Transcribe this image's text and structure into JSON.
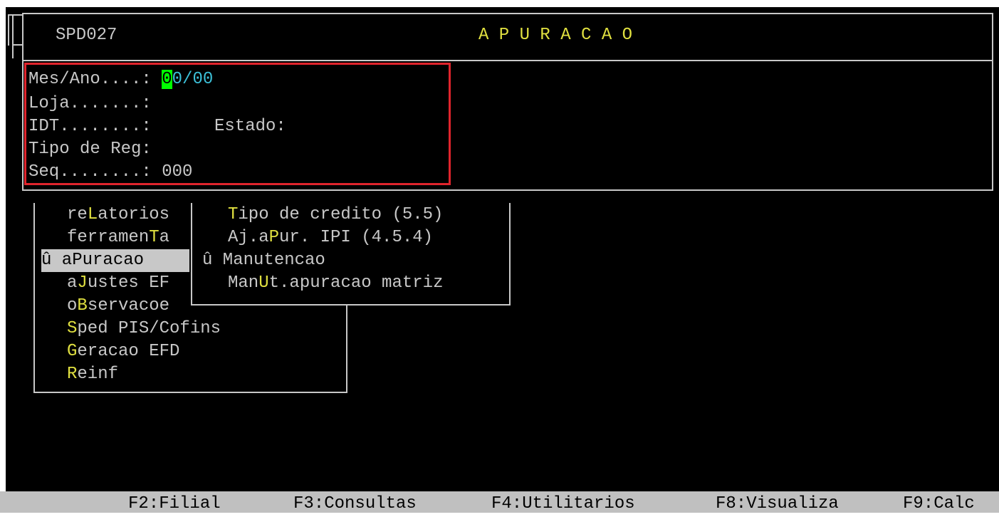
{
  "header": {
    "program_code": "SPD027",
    "title": "A P U R A C A O"
  },
  "form": {
    "mes_ano_label": "Mes/Ano....: ",
    "mes_ano_cursor": "0",
    "mes_ano_rest": "0/00",
    "loja_label": "Loja.......:",
    "idt_label": "IDT........:",
    "estado_label": "Estado:",
    "tipo_reg_label": "Tipo de Reg:",
    "seq_label": "Seq........: ",
    "seq_value": "000"
  },
  "main_menu": {
    "items": [
      {
        "pre": "re",
        "hot": "L",
        "post": "atorios",
        "selected": false
      },
      {
        "pre": "ferramen",
        "hot": "T",
        "post": "a",
        "selected": false
      },
      {
        "pre": "û aPuracao",
        "hot": "",
        "post": "",
        "selected": true
      },
      {
        "pre": "a",
        "hot": "J",
        "post": "ustes EF",
        "selected": false
      },
      {
        "pre": "o",
        "hot": "B",
        "post": "servacoe",
        "selected": false
      },
      {
        "pre": "",
        "hot": "S",
        "post": "ped PIS/Cofins",
        "selected": false
      },
      {
        "pre": "",
        "hot": "G",
        "post": "eracao EFD",
        "selected": false
      },
      {
        "pre": "",
        "hot": "R",
        "post": "einf",
        "selected": false
      }
    ]
  },
  "sub_menu": {
    "items": [
      {
        "pre": "",
        "hot": "T",
        "post": "ipo de credito (5.5)"
      },
      {
        "pre": "Aj.a",
        "hot": "P",
        "post": "ur. IPI (4.5.4)"
      },
      {
        "pre": "û Manutencao",
        "hot": "",
        "post": ""
      },
      {
        "pre": "Man",
        "hot": "U",
        "post": "t.apuracao matriz"
      }
    ]
  },
  "status_bar": {
    "f2": "F2:Filial",
    "f3": "F3:Consultas",
    "f4": "F4:Utilitarios",
    "f8": "F8:Visualiza",
    "f9": "F9:Calc"
  },
  "colors": {
    "highlight": "#e0e040",
    "field_value": "#3cc0d8",
    "cursor": "#00ff00",
    "focus_box": "#e0242c"
  }
}
